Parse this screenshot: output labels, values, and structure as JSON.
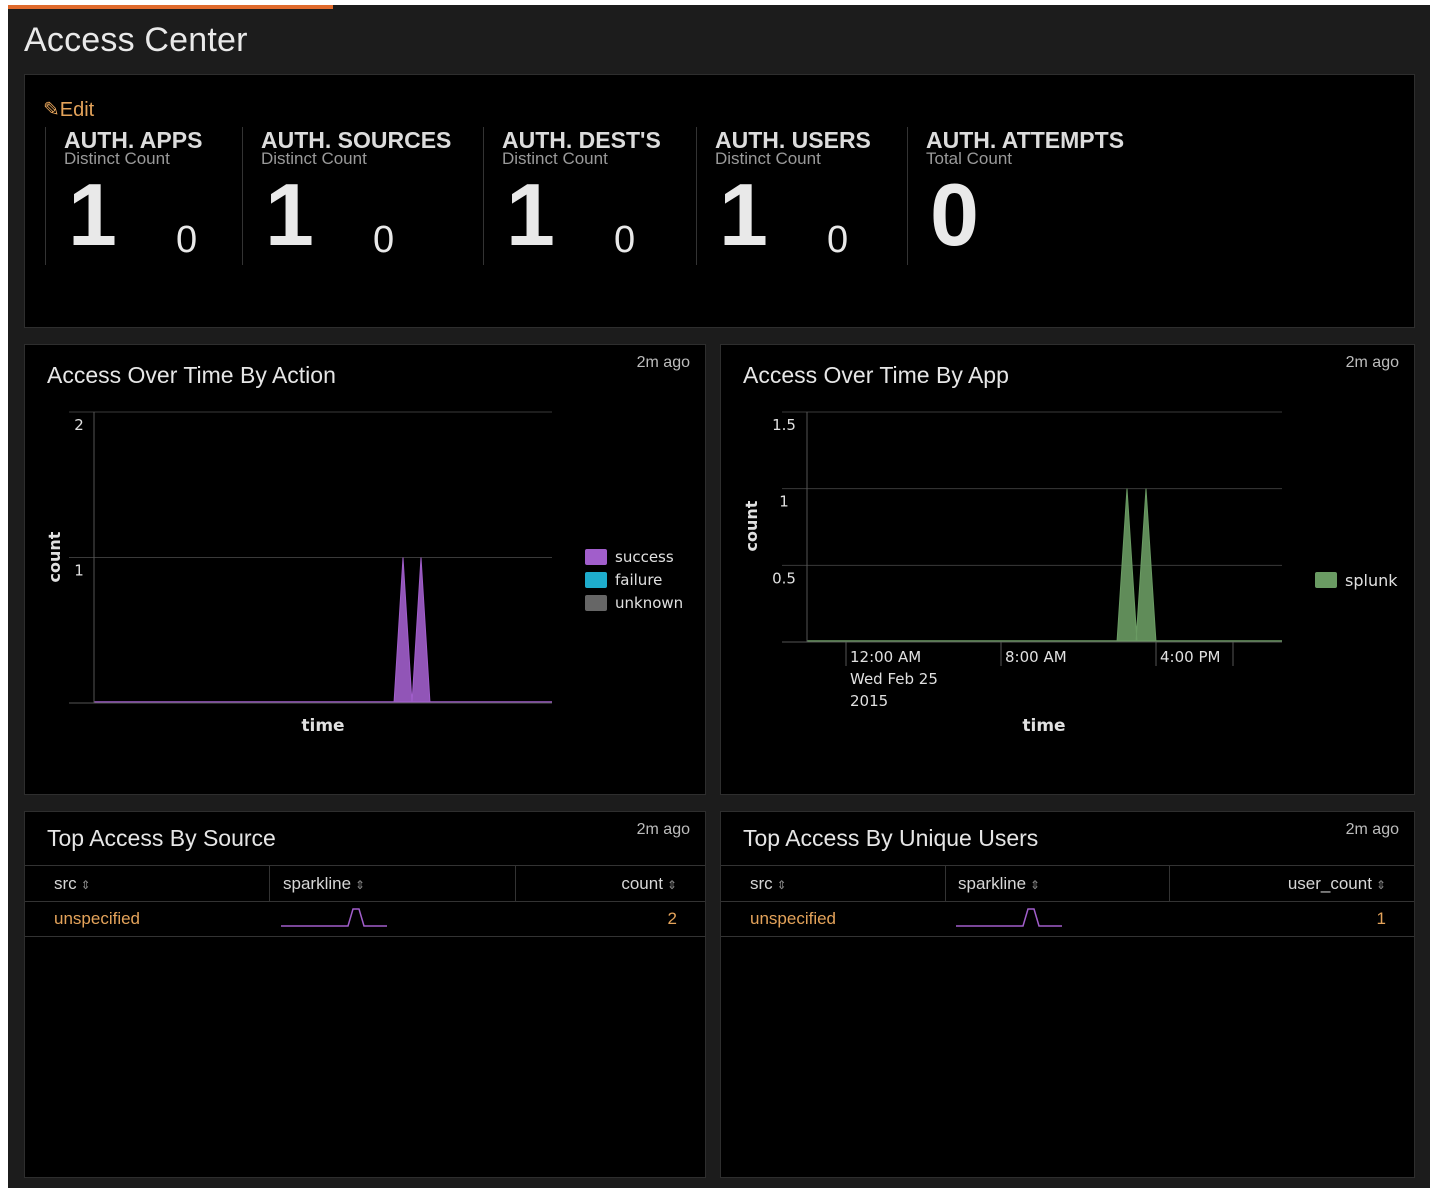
{
  "app": {
    "title": "Access Center",
    "accent_color": "#e06a2c"
  },
  "kpis": {
    "edit_label": "Edit",
    "items": [
      {
        "title": "AUTH. APPS",
        "subtitle": "Distinct Count",
        "value": "1",
        "delta": "0"
      },
      {
        "title": "AUTH. SOURCES",
        "subtitle": "Distinct Count",
        "value": "1",
        "delta": "0"
      },
      {
        "title": "AUTH. DEST'S",
        "subtitle": "Distinct Count",
        "value": "1",
        "delta": "0"
      },
      {
        "title": "AUTH. USERS",
        "subtitle": "Distinct Count",
        "value": "1",
        "delta": "0"
      },
      {
        "title": "AUTH. ATTEMPTS",
        "subtitle": "Total Count",
        "value": "0"
      }
    ]
  },
  "panels": {
    "action": {
      "title": "Access Over Time By Action",
      "ago": "2m ago"
    },
    "app": {
      "title": "Access Over Time By App",
      "ago": "2m ago"
    },
    "source": {
      "title": "Top Access By Source",
      "ago": "2m ago"
    },
    "users": {
      "title": "Top Access By Unique Users",
      "ago": "2m ago"
    }
  },
  "chart_data": [
    {
      "type": "area",
      "title": "Access Over Time By Action",
      "xlabel": "time",
      "ylabel": "count",
      "ylim": [
        0,
        2
      ],
      "yticks": [
        "1",
        "2"
      ],
      "grid": true,
      "legend_position": "right",
      "series": [
        {
          "name": "success",
          "color": "#a15ecb",
          "spikes": [
            1,
            1
          ]
        },
        {
          "name": "failure",
          "color": "#1eaccc",
          "spikes": []
        },
        {
          "name": "unknown",
          "color": "#666666",
          "spikes": []
        }
      ]
    },
    {
      "type": "area",
      "title": "Access Over Time By App",
      "xlabel": "time",
      "ylabel": "count",
      "ylim": [
        0,
        1.5
      ],
      "yticks": [
        "0.5",
        "1",
        "1.5"
      ],
      "xticks": [
        "12:00 AM\nWed Feb 25\n2015",
        "8:00 AM",
        "4:00 PM"
      ],
      "grid": true,
      "legend_position": "right",
      "series": [
        {
          "name": "splunk",
          "color": "#6a9b63",
          "spikes": [
            1,
            1
          ]
        }
      ]
    }
  ],
  "tables": {
    "source": {
      "columns": [
        "src",
        "sparkline",
        "count"
      ],
      "rows": [
        {
          "src": "unspecified",
          "value": "2"
        }
      ]
    },
    "users": {
      "columns": [
        "src",
        "sparkline",
        "user_count"
      ],
      "rows": [
        {
          "src": "unspecified",
          "value": "1"
        }
      ]
    }
  }
}
